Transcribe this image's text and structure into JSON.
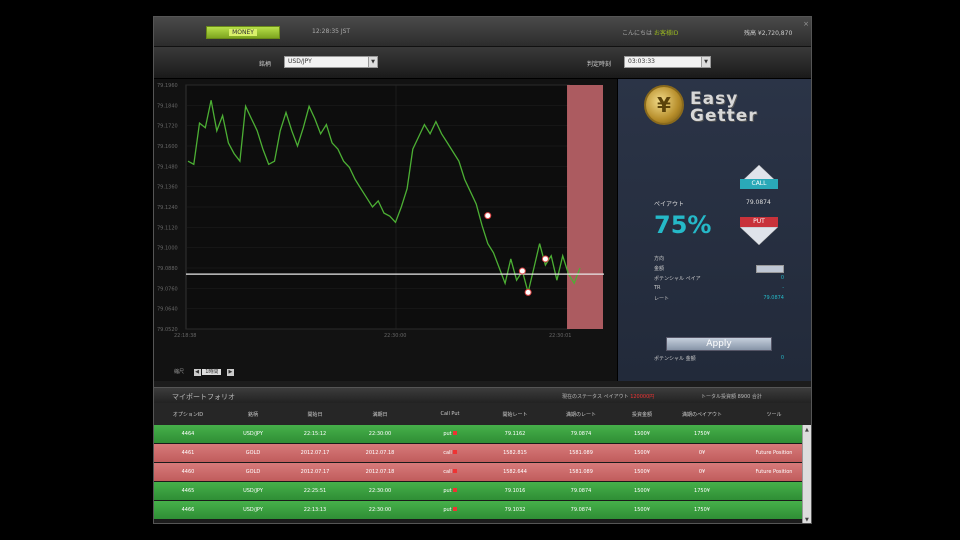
{
  "topbar": {
    "logo_prefix": "",
    "logo_mid": "MONEY",
    "server_time": "12:28:35 JST",
    "welcome_prefix": "こんにちは",
    "welcome_user": "お客様ID",
    "balance": "残高 ¥2,720,870",
    "close": "×"
  },
  "selectors": {
    "asset_label": "銘柄",
    "asset_value": "USD/JPY",
    "expiry_label": "判定時刻",
    "expiry_value": "03:03:33"
  },
  "chart_data": {
    "type": "line",
    "title": "",
    "y_ticks": [
      "79.1960",
      "79.1840",
      "79.1720",
      "79.1600",
      "79.1480",
      "79.1360",
      "79.1240",
      "79.1120",
      "79.1000",
      "79.0880",
      "79.0760",
      "79.0640",
      "79.0520"
    ],
    "x_ticks": [
      "22:18:38",
      "22:30:00",
      "22:30:01"
    ],
    "strike": 79.076,
    "ylim": [
      79.04,
      79.2
    ],
    "series": [
      {
        "values": [
          79.15,
          79.148,
          79.175,
          79.172,
          79.19,
          79.17,
          79.18,
          79.162,
          79.155,
          79.15,
          79.186,
          79.178,
          79.17,
          79.158,
          79.148,
          79.15,
          79.17,
          79.182,
          79.17,
          79.16,
          79.172,
          79.186,
          79.178,
          79.168,
          79.174,
          79.162,
          79.158,
          79.15,
          79.146,
          79.138,
          79.132,
          79.126,
          79.12,
          79.124,
          79.116,
          79.114,
          79.11,
          79.12,
          79.132,
          79.158,
          79.166,
          79.174,
          79.168,
          79.176,
          79.168,
          79.162,
          79.156,
          79.15,
          79.138,
          79.13,
          79.122,
          79.108,
          79.096,
          79.09,
          79.08,
          79.07,
          79.086,
          79.072,
          79.078,
          79.064,
          79.08,
          79.096,
          79.082,
          79.088,
          79.072,
          79.088,
          79.076,
          79.07,
          79.08
        ],
        "markers": [
          59,
          58
        ]
      }
    ],
    "zoom_label": "縮尺",
    "zoom_value": "1時間"
  },
  "panel": {
    "brand_line1": "Easy",
    "brand_line2": "Getter",
    "coin_symbol": "¥",
    "payout_label": "ペイアウト",
    "payout_pct": "75%",
    "payout_value": "79.0874",
    "call_label": "CALL",
    "put_label": "PUT",
    "info_rows": [
      {
        "label": "方向",
        "value": ""
      },
      {
        "label": "金額",
        "value": ""
      },
      {
        "label": "ポテンシャル ペイア",
        "value": "0"
      },
      {
        "label": "TR",
        "value": "-"
      },
      {
        "label": "レート",
        "value": "79.0874"
      }
    ],
    "apply_label": "Apply",
    "potential_label": "ポテンシャル 金額",
    "potential_value": "0"
  },
  "portfolio": {
    "title": "マイポートフォリオ",
    "status_label": "現在のステータス ペイアウト",
    "status_value": "120000円",
    "total_label": "トータル投資額",
    "total_value": "8900 合計",
    "columns": [
      "オプションID",
      "銘柄",
      "開始日",
      "満期日",
      "Call Put",
      "開始レート",
      "満期のレート",
      "投資金額",
      "満期のペイアウト",
      "ツール"
    ],
    "rows": [
      {
        "color": "green",
        "cells": [
          "4464",
          "USD/JPY",
          "22:15:12",
          "22:30:00",
          "put",
          "79.1162",
          "79.0874",
          "1500¥",
          "1750¥",
          ""
        ]
      },
      {
        "color": "red",
        "cells": [
          "4461",
          "GOLD",
          "2012.07.17",
          "2012.07.18",
          "call",
          "1582.815",
          "1581.089",
          "1500¥",
          "0¥",
          "Future Position"
        ]
      },
      {
        "color": "red",
        "cells": [
          "4460",
          "GOLD",
          "2012.07.17",
          "2012.07.18",
          "call",
          "1582.644",
          "1581.089",
          "1500¥",
          "0¥",
          "Future Position"
        ]
      },
      {
        "color": "green",
        "cells": [
          "4465",
          "USD/JPY",
          "22:25:51",
          "22:30:00",
          "put",
          "79.1016",
          "79.0874",
          "1500¥",
          "1750¥",
          ""
        ]
      },
      {
        "color": "green",
        "cells": [
          "4466",
          "USD/JPY",
          "22:13:13",
          "22:30:00",
          "put",
          "79.1032",
          "79.0874",
          "1500¥",
          "1750¥",
          ""
        ]
      }
    ]
  },
  "colors": {
    "accent": "#25b9c8",
    "call": "#2aa9b8",
    "put": "#c8323a",
    "line": "#4caf34",
    "expiry_zone": "#c8686e"
  }
}
